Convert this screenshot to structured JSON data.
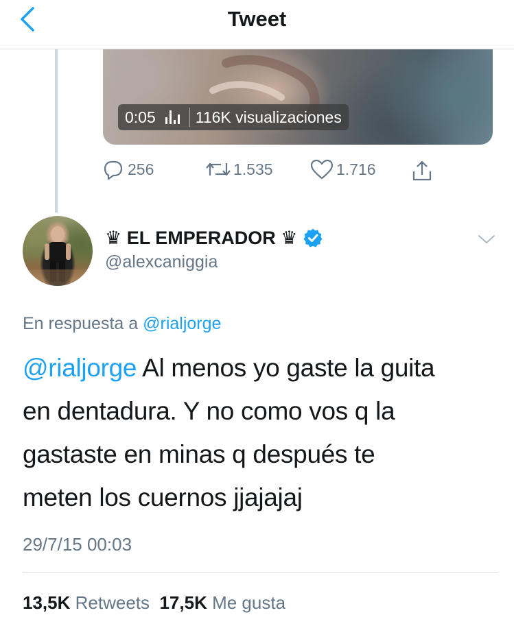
{
  "header": {
    "title": "Tweet",
    "back_icon": "chevron-left-icon"
  },
  "media": {
    "time": "0:05",
    "views": "116K visualizaciones",
    "audio_icon": "audio-bars-icon"
  },
  "actions": {
    "replies": "256",
    "retweets": "1.535",
    "likes": "1.716",
    "icons": [
      "reply-icon",
      "retweet-icon",
      "like-icon",
      "share-icon"
    ]
  },
  "tweet": {
    "display_name": "♛ EL EMPERADOR ♛",
    "handle": "@alexcaniggia",
    "reply_prefix": "En respuesta a",
    "reply_to": "@rialjorge",
    "text_mention": "@rialjorge",
    "text_line1_rest": " Al menos yo gaste la guita",
    "text_line2": "en dentadura. Y no como vos q la",
    "text_line3": "gastaste en minas q después te",
    "text_line4": "meten los cuernos jjajajaj",
    "timestamp": "29/7/15 00:03"
  },
  "stats": {
    "retweets_count": "13,5K",
    "retweets_label": "Retweets",
    "likes_count": "17,5K",
    "likes_label": "Me gusta"
  },
  "colors": {
    "accent": "#1da1f2",
    "secondary_text": "#657786",
    "primary_text": "#14171a",
    "divider": "#d9dde1"
  }
}
